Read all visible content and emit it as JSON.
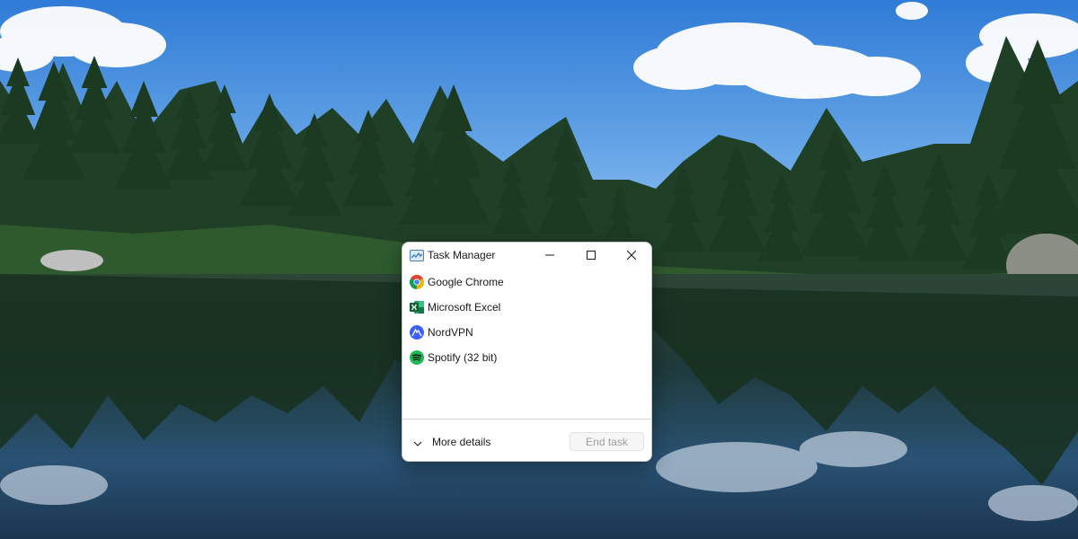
{
  "wallpaper": {
    "sky_top": "#2f7bd6",
    "sky_bottom": "#9cc8ef",
    "forest": "#1f3a24",
    "water": "#1d3448"
  },
  "window": {
    "title": "Task Manager",
    "icons": {
      "app": "task-manager-icon",
      "minimize": "minimize-icon",
      "maximize": "maximize-icon",
      "close": "close-icon"
    }
  },
  "processes": [
    {
      "label": "Google Chrome",
      "icon": "chrome-icon"
    },
    {
      "label": "Microsoft Excel",
      "icon": "excel-icon"
    },
    {
      "label": "NordVPN",
      "icon": "nordvpn-icon"
    },
    {
      "label": "Spotify (32 bit)",
      "icon": "spotify-icon"
    }
  ],
  "footer": {
    "more_details_label": "More details",
    "end_task_label": "End task",
    "end_task_enabled": false
  },
  "colors": {
    "excel_green": "#1d6f42",
    "spotify_green": "#1db954",
    "nordvpn_blue": "#3e5fff",
    "chrome_red": "#db4437",
    "chrome_yellow": "#f4b400",
    "chrome_green": "#0f9d58",
    "chrome_blue": "#4285f4"
  }
}
